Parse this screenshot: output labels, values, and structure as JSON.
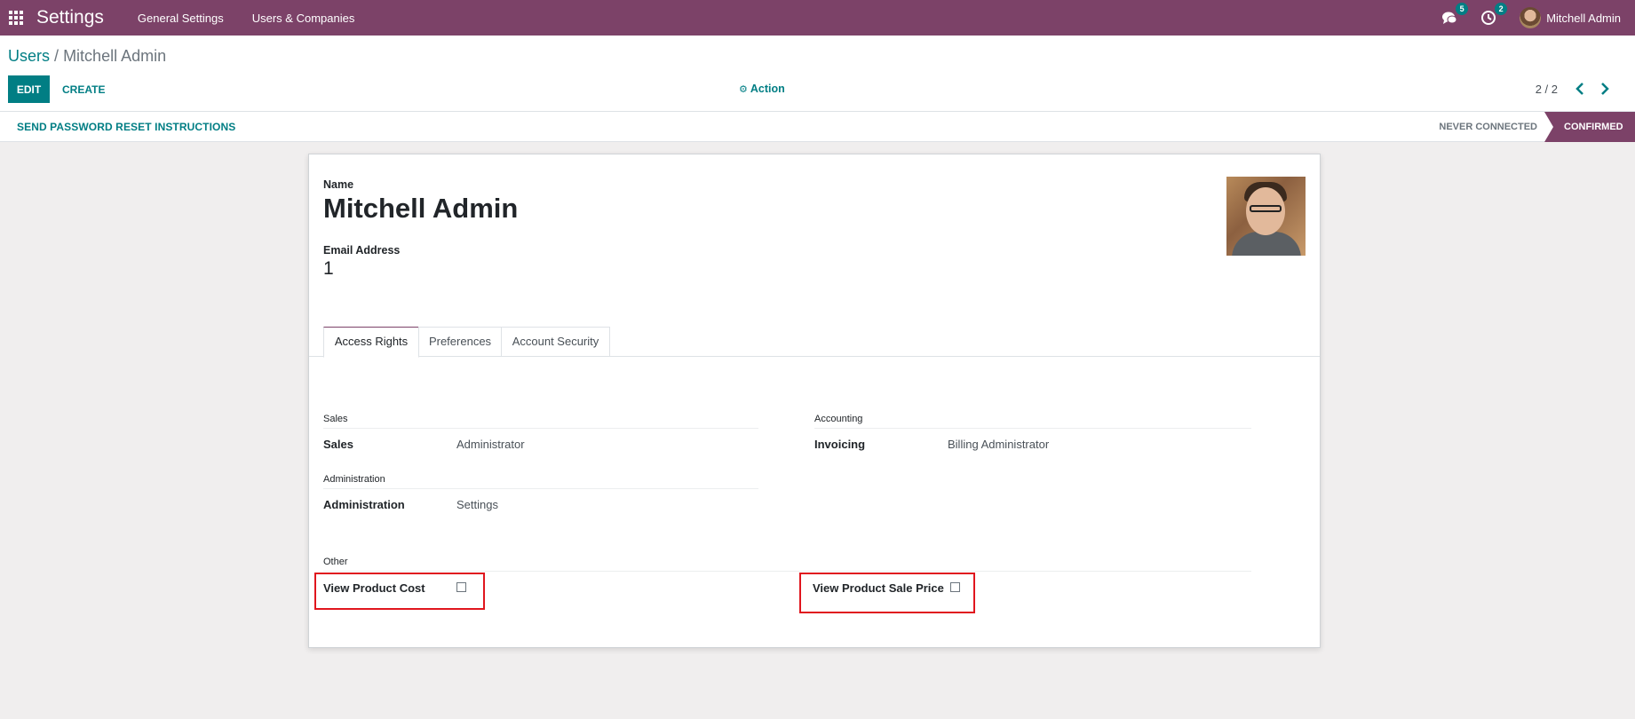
{
  "navbar": {
    "app_name": "Settings",
    "menus": [
      "General Settings",
      "Users & Companies"
    ],
    "messages_badge": "5",
    "activities_badge": "2",
    "user_name": "Mitchell Admin"
  },
  "control_panel": {
    "breadcrumb_parent": "Users",
    "breadcrumb_sep": "/",
    "breadcrumb_current": "Mitchell Admin",
    "edit_label": "EDIT",
    "create_label": "CREATE",
    "action_label": "Action",
    "pager": "2 / 2"
  },
  "statusbar": {
    "reset_label": "SEND PASSWORD RESET INSTRUCTIONS",
    "stages": [
      "NEVER CONNECTED",
      "CONFIRMED"
    ],
    "active_stage": "CONFIRMED"
  },
  "form": {
    "name_label": "Name",
    "name_value": "Mitchell Admin",
    "email_label": "Email Address",
    "email_value": "1",
    "tabs": [
      "Access Rights",
      "Preferences",
      "Account Security"
    ],
    "active_tab": "Access Rights",
    "groups": {
      "sales": {
        "title": "Sales",
        "field_label": "Sales",
        "field_value": "Administrator"
      },
      "accounting": {
        "title": "Accounting",
        "field_label": "Invoicing",
        "field_value": "Billing Administrator"
      },
      "administration": {
        "title": "Administration",
        "field_label": "Administration",
        "field_value": "Settings"
      },
      "other": {
        "title": "Other",
        "view_product_cost_label": "View Product Cost",
        "view_product_cost_checked": false,
        "view_product_sale_price_label": "View Product Sale Price",
        "view_product_sale_price_checked": false
      }
    }
  },
  "colors": {
    "brand": "#7c4268",
    "accent": "#017e84",
    "highlight": "#e0161e"
  }
}
